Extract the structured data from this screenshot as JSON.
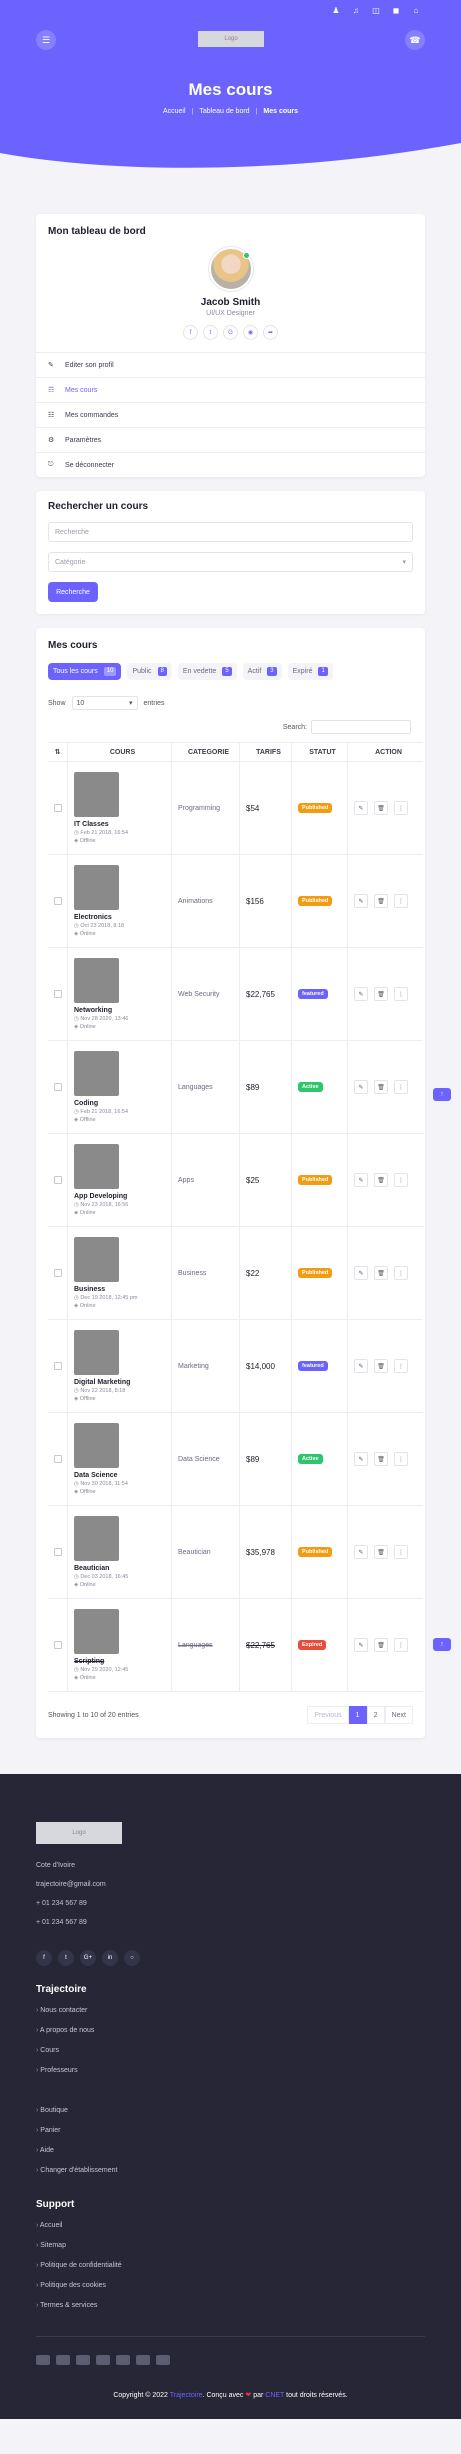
{
  "topbar": {
    "icons": [
      "user-icon",
      "megaphone-icon",
      "cart-icon",
      "truck-icon",
      "home-icon"
    ]
  },
  "header": {
    "logo_text": "Logo",
    "title": "Mes cours",
    "breadcrumb": [
      "Accueil",
      "Tableau de bord",
      "Mes cours"
    ]
  },
  "dashboard": {
    "title": "Mon tableau de bord",
    "user_name": "Jacob Smith",
    "user_role": "UI/UX Designer",
    "socials": [
      "facebook-icon",
      "twitter-icon",
      "google-icon",
      "instagram-icon",
      "share-icon"
    ],
    "menu": [
      {
        "label": "Editer son profil",
        "icon": "edit-icon"
      },
      {
        "label": "Mes cours",
        "icon": "book-icon"
      },
      {
        "label": "Mes commandes",
        "icon": "orders-icon"
      },
      {
        "label": "Paramètres",
        "icon": "settings-icon"
      },
      {
        "label": "Se déconnecter",
        "icon": "logout-icon"
      }
    ]
  },
  "search": {
    "title": "Rechercher un cours",
    "placeholder": "Recherche",
    "category_placeholder": "Catégorie",
    "button": "Recherche"
  },
  "courses": {
    "title": "Mes cours",
    "filters": [
      {
        "label": "Tous les cours",
        "count": "10"
      },
      {
        "label": "Public",
        "count": "8"
      },
      {
        "label": "En vedette",
        "count": "5"
      },
      {
        "label": "Actif",
        "count": "3"
      },
      {
        "label": "Expiré",
        "count": "1"
      }
    ],
    "show_label": "Show",
    "show_value": "10",
    "entries_label": "entries",
    "search_label": "Search:",
    "columns": [
      "COURS",
      "CATEGORIE",
      "TARIFS",
      "STATUT",
      "ACTION"
    ],
    "rows": [
      {
        "title": "IT Classes",
        "date": "Feb 21 2018, 16:54",
        "mode": "Offline",
        "category": "Programming",
        "price": "$54",
        "status": "Published"
      },
      {
        "title": "Electronics",
        "date": "Oct 23 2018, 8:18",
        "mode": "Online",
        "category": "Animations",
        "price": "$156",
        "status": "Published"
      },
      {
        "title": "Networking",
        "date": "Nov 28 2020, 13:46",
        "mode": "Online",
        "category": "Web Security",
        "price": "$22,765",
        "status": "featured"
      },
      {
        "title": "Coding",
        "date": "Feb 21 2018, 16:54",
        "mode": "Offline",
        "category": "Languages",
        "price": "$89",
        "status": "Active"
      },
      {
        "title": "App Developing",
        "date": "Nov 23 2018, 16:56",
        "mode": "Online",
        "category": "Apps",
        "price": "$25",
        "status": "Published"
      },
      {
        "title": "Business",
        "date": "Dec 19 2018, 12:45 pm",
        "mode": "Online",
        "category": "Business",
        "price": "$22",
        "status": "Published"
      },
      {
        "title": "Digital Marketing",
        "date": "Nov 22 2018, 8:18",
        "mode": "Offline",
        "category": "Marketing",
        "price": "$14,000",
        "status": "featured"
      },
      {
        "title": "Data Science",
        "date": "Nov 30 2018, 11:54",
        "mode": "Offline",
        "category": "Data Science",
        "price": "$89",
        "status": "Active"
      },
      {
        "title": "Beautician",
        "date": "Dec 03 2018, 16:45",
        "mode": "Online",
        "category": "Beautician",
        "price": "$35,978",
        "status": "Published"
      },
      {
        "title": "Scripting",
        "date": "Nov 29 2020, 12:45",
        "mode": "Online",
        "category": "Languages",
        "price": "$22,765",
        "status": "Expired"
      }
    ],
    "status_colors": {
      "Published": "#f39c12",
      "featured": "#6c63ff",
      "Active": "#2ec56b",
      "Expired": "#e74c3c"
    },
    "showing": "Showing 1 to 10 of 20 entries",
    "pager": {
      "prev": "Previous",
      "p1": "1",
      "p2": "2",
      "next": "Next"
    }
  },
  "footer": {
    "logo_text": "Logo",
    "contact": [
      "Cote d'Ivoire",
      "trajectoire@gmail.com",
      "+ 01 234 567 89",
      "+ 01 234 567 89"
    ],
    "socials": [
      "facebook-icon",
      "twitter-icon",
      "google-plus-icon",
      "linkedin-icon",
      "github-icon"
    ],
    "section1_title": "Trajectoire",
    "links1": [
      "Nous contacter",
      "A propos de nous",
      "Cours",
      "Professeurs"
    ],
    "links2": [
      "Boutique",
      "Panier",
      "Aide",
      "Changer d'établissement"
    ],
    "section2_title": "Support",
    "links3": [
      "Accueil",
      "Sitemap",
      "Politique de confidentialité",
      "Politique des cookies",
      "Termes & services"
    ],
    "copyright_pre": "Copyright © 2022",
    "copyright_brand": "Trajectoire",
    "copyright_mid": ". Conçu avec",
    "copyright_by": "par",
    "copyright_author": "CNET",
    "copyright_post": "tout droits réservés."
  },
  "colors": {
    "accent": "#6c63ff",
    "footer_bg": "#262637",
    "page_bg": "#f4f4f8"
  }
}
